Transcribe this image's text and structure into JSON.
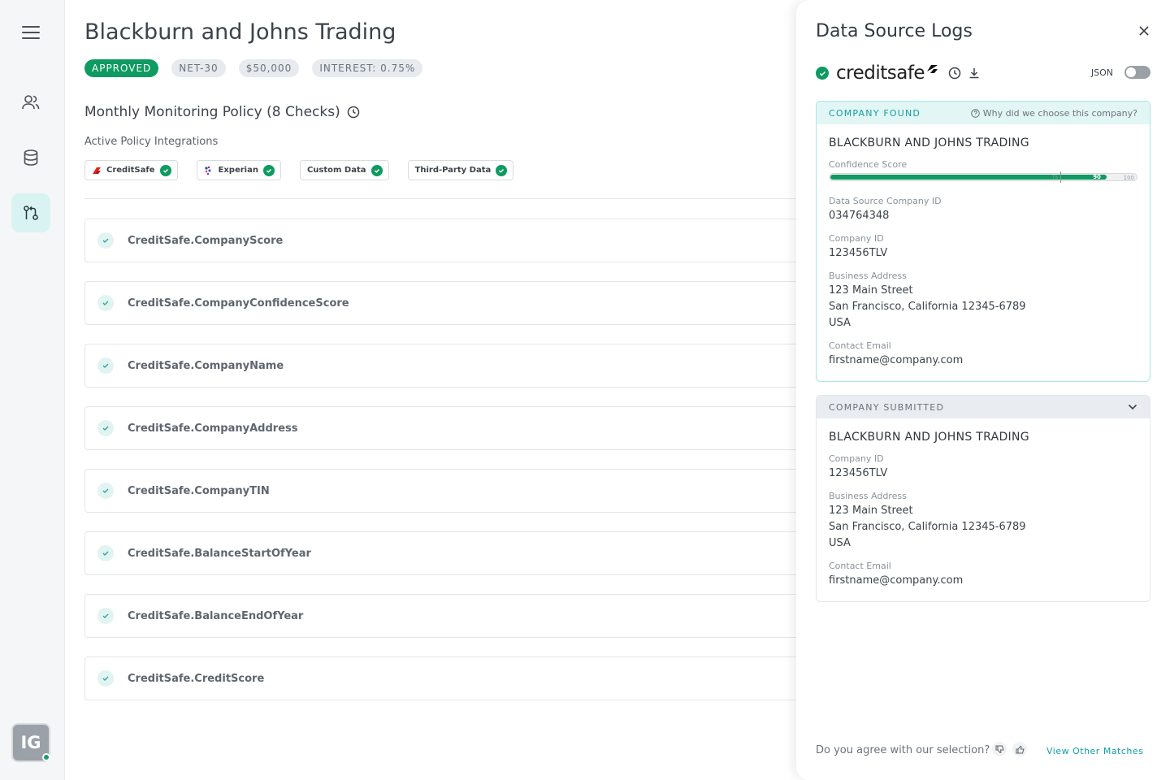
{
  "header": {
    "company": "Blackburn and Johns Trading",
    "badges": [
      "APPROVED",
      "NET-30",
      "$50,000",
      "INTEREST: 0.75%"
    ]
  },
  "policy": {
    "title": "Monthly Monitoring Policy (8 Checks)",
    "integrations_label": "Active Policy Integrations",
    "integrations": [
      "CreditSafe",
      "Experian",
      "Custom Data",
      "Third-Party Data"
    ],
    "checks": [
      "CreditSafe.CompanyScore",
      "CreditSafe.CompanyConfidenceScore",
      "CreditSafe.CompanyName",
      "CreditSafe.CompanyAddress",
      "CreditSafe.CompanyTIN",
      "CreditSafe.BalanceStartOfYear",
      "CreditSafe.BalanceEndOfYear",
      "CreditSafe.CreditScore"
    ]
  },
  "sidebar": {
    "avatar_initials": "IG",
    "items": [
      "menu-icon",
      "users-icon",
      "database-icon",
      "integrations-icon"
    ]
  },
  "panel": {
    "title": "Data Source Logs",
    "brand": "creditsafe",
    "json_label": "JSON",
    "found": {
      "label": "COMPANY FOUND",
      "why_link": "Why did we choose this company?",
      "company": "BLACKBURN AND JOHNS TRADING",
      "confidence_label": "Confidence Score",
      "confidence": 90,
      "confidence_threshold": 75,
      "confidence_max": 100,
      "confidence_threshold_text": "75",
      "confidence_value_text": "90",
      "confidence_max_text": "100",
      "ds_id_label": "Data Source Company ID",
      "ds_id": "034764348",
      "company_id_label": "Company ID",
      "company_id": "123456TLV",
      "address_label": "Business Address",
      "address_line1": "123 Main Street",
      "address_line2": "San Francisco, California 12345-6789",
      "address_line3": "USA",
      "email_label": "Contact Email",
      "email": "firstname@company.com"
    },
    "submitted": {
      "label": "COMPANY SUBMITTED",
      "company": "BLACKBURN AND JOHNS TRADING",
      "company_id_label": "Company ID",
      "company_id": "123456TLV",
      "address_label": "Business Address",
      "address_line1": "123 Main Street",
      "address_line2": "San Francisco, California 12345-6789",
      "address_line3": "USA",
      "email_label": "Contact Email",
      "email": "firstname@company.com"
    },
    "footer": {
      "question": "Do you agree with our selection?",
      "view_link": "View Other Matches"
    }
  },
  "colors": {
    "accent": "#12a0a0",
    "success": "#0e9a60",
    "creditsafe_red": "#e2231a"
  }
}
